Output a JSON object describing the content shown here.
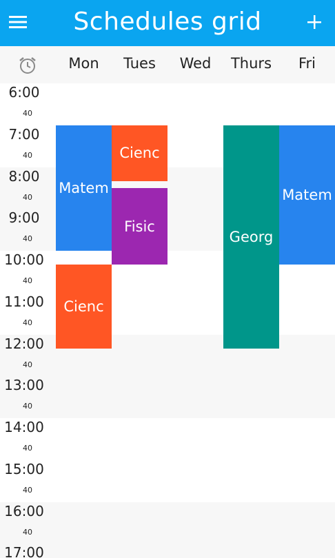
{
  "header": {
    "title": "Schedules grid",
    "menu_icon": "hamburger-menu-icon",
    "add_icon": "plus-icon",
    "background": "#0AA5F0"
  },
  "day_header": {
    "alarm_icon": "alarm-clock-icon",
    "days": [
      "Mon",
      "Tues",
      "Wed",
      "Thurs",
      "Fri"
    ]
  },
  "hours": [
    {
      "label": "6:00",
      "sub": "40"
    },
    {
      "label": "7:00",
      "sub": "40"
    },
    {
      "label": "8:00",
      "sub": "40"
    },
    {
      "label": "9:00",
      "sub": "40"
    },
    {
      "label": "10:00",
      "sub": "40"
    },
    {
      "label": "11:00",
      "sub": "40"
    },
    {
      "label": "12:00",
      "sub": "40"
    },
    {
      "label": "13:00",
      "sub": "40"
    },
    {
      "label": "14:00",
      "sub": "40"
    },
    {
      "label": "15:00",
      "sub": "40"
    },
    {
      "label": "16:00",
      "sub": "40"
    },
    {
      "label": "17:00",
      "sub": ""
    }
  ],
  "colors": {
    "blue": "#2784EE",
    "orange": "#FF5624",
    "purple": "#9C27B0",
    "teal": "#00968A",
    "shade": "#F7F7F7"
  },
  "events": [
    {
      "label": "Matem",
      "day": "Mon",
      "start": "7:00",
      "end": "10:00",
      "color": "#2784EE"
    },
    {
      "label": "Cienc",
      "day": "Tues",
      "start": "7:00",
      "end": "8:20",
      "color": "#FF5624"
    },
    {
      "label": "Fisic",
      "day": "Tues",
      "start": "8:30",
      "end": "10:20",
      "color": "#9C27B0"
    },
    {
      "label": "Cienc",
      "day": "Mon",
      "start": "10:20",
      "end": "12:20",
      "color": "#FF5624"
    },
    {
      "label": "Georg",
      "day": "Thurs",
      "start": "7:00",
      "end": "12:20",
      "color": "#00968A"
    },
    {
      "label": "Matem",
      "day": "Fri",
      "start": "7:00",
      "end": "10:20",
      "color": "#2784EE"
    }
  ]
}
